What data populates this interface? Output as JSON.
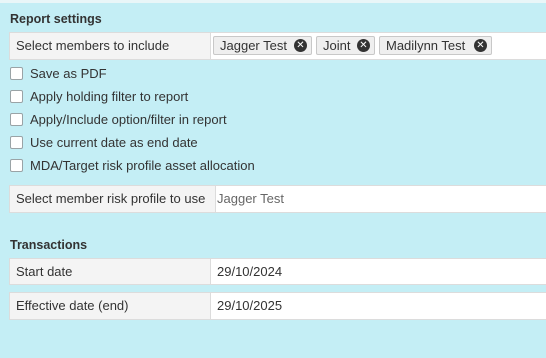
{
  "report_settings": {
    "title": "Report settings",
    "members": {
      "label": "Select members to include",
      "chips": [
        {
          "label": "Jagger Test"
        },
        {
          "label": "Joint"
        },
        {
          "label": "Madilynn Test"
        }
      ]
    },
    "options": [
      {
        "label": "Save as PDF",
        "checked": false
      },
      {
        "label": "Apply holding filter to report",
        "checked": false
      },
      {
        "label": "Apply/Include option/filter in report",
        "checked": false
      },
      {
        "label": "Use current date as end date",
        "checked": false
      },
      {
        "label": "MDA/Target risk profile asset allocation",
        "checked": false
      }
    ],
    "risk_profile": {
      "label": "Select member risk profile to use",
      "value": "Jagger Test"
    }
  },
  "transactions": {
    "title": "Transactions",
    "start_date": {
      "label": "Start date",
      "value": "29/10/2024"
    },
    "end_date": {
      "label": "Effective date (end)",
      "value": "29/10/2025"
    }
  },
  "icons": {
    "chip_remove": "close-circle-icon"
  }
}
